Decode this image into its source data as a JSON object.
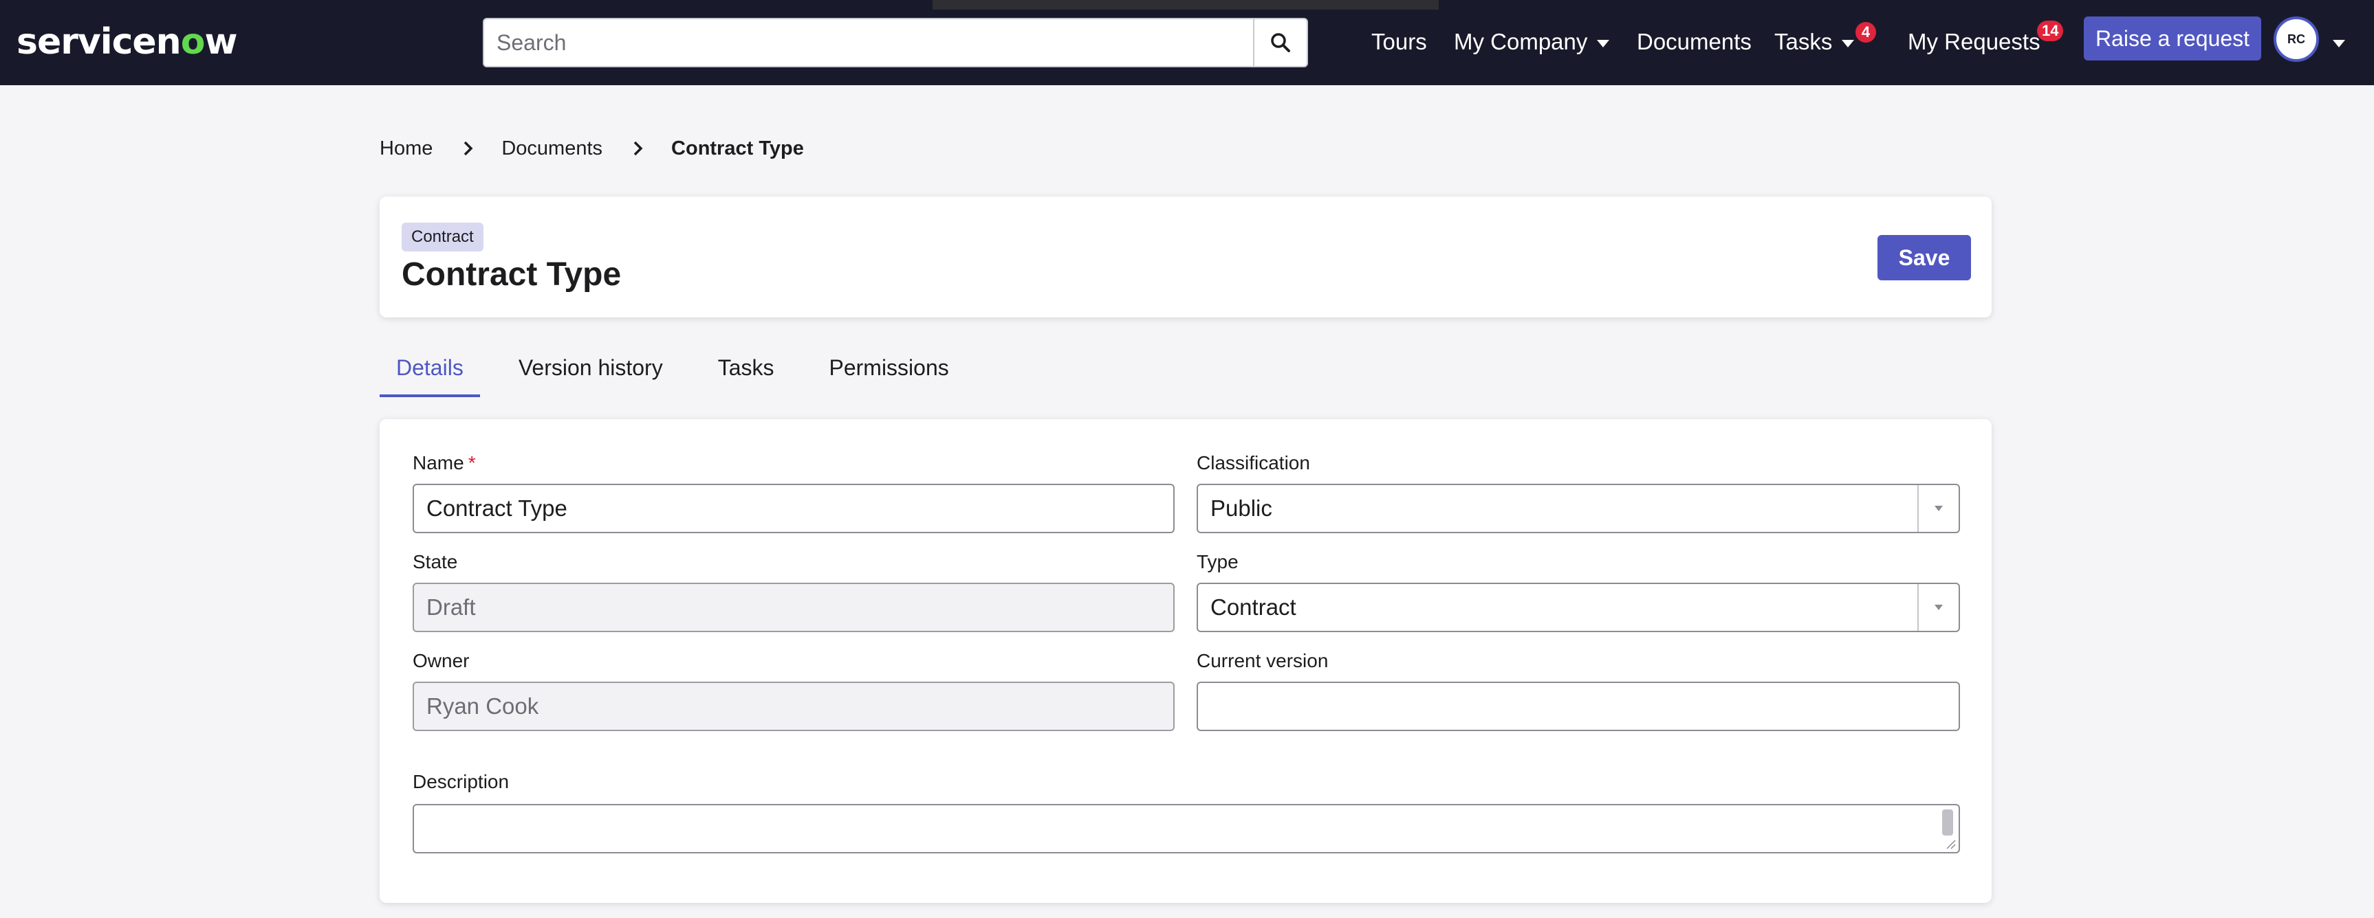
{
  "nav": {
    "brand_left": "servicen",
    "brand_o": "o",
    "brand_right": "w",
    "search_placeholder": "Search",
    "links": {
      "tours": "Tours",
      "my_company": "My Company",
      "documents": "Documents",
      "tasks": "Tasks",
      "tasks_count": "4",
      "my_requests": "My Requests",
      "my_requests_count": "14"
    },
    "raise_request": "Raise a request",
    "avatar_initials": "RC"
  },
  "breadcrumb": [
    "Home",
    "Documents",
    "Contract Type"
  ],
  "header": {
    "type_pill": "Contract",
    "title": "Contract Type",
    "save_label": "Save"
  },
  "tabs": [
    "Details",
    "Version history",
    "Tasks",
    "Permissions"
  ],
  "form": {
    "name": {
      "label": "Name",
      "required_mark": "*",
      "value": "Contract Type"
    },
    "classification": {
      "label": "Classification",
      "value": "Public"
    },
    "state": {
      "label": "State",
      "value": "Draft"
    },
    "type": {
      "label": "Type",
      "value": "Contract"
    },
    "owner": {
      "label": "Owner",
      "value": "Ryan Cook"
    },
    "current_version": {
      "label": "Current version",
      "value": ""
    },
    "description": {
      "label": "Description",
      "value": ""
    }
  },
  "colors": {
    "nav_bg": "#181a2b",
    "accent": "#5157c0",
    "badge": "#e0243c",
    "brand_o": "#62d84e",
    "required": "#d21d32"
  }
}
